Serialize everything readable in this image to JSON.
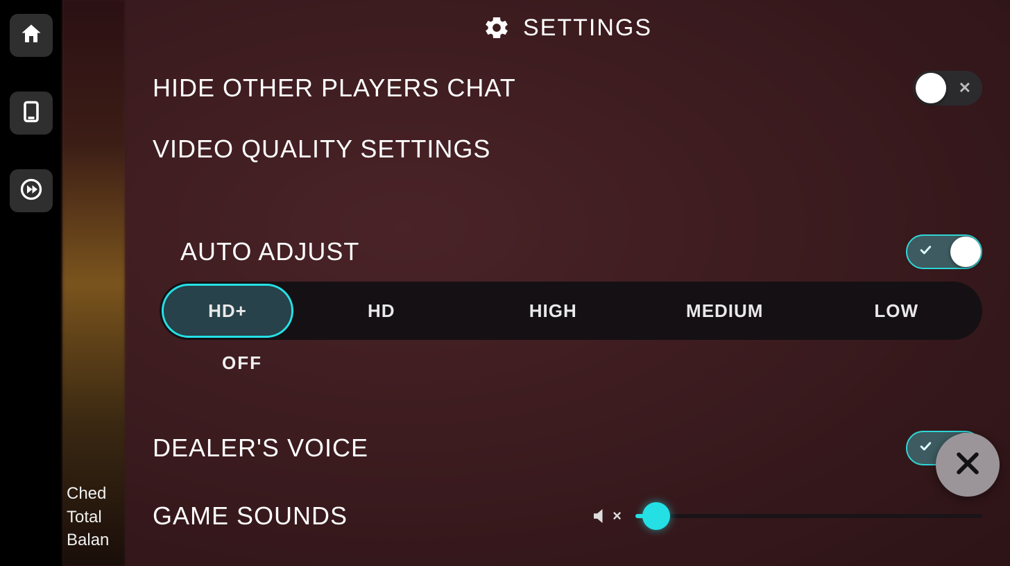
{
  "header": {
    "title": "SETTINGS"
  },
  "rows": {
    "hide_chat": {
      "label": "HIDE OTHER PLAYERS CHAT",
      "state": "off"
    },
    "video_quality_section": {
      "label": "VIDEO QUALITY SETTINGS"
    },
    "auto_adjust": {
      "label": "AUTO ADJUST",
      "state": "on"
    },
    "dealers_voice": {
      "label": "DEALER'S VOICE",
      "state": "on"
    },
    "game_sounds": {
      "label": "GAME SOUNDS",
      "slider_value": 6
    }
  },
  "quality": {
    "options": [
      "HD+",
      "HD",
      "HIGH",
      "MEDIUM",
      "LOW"
    ],
    "selected": "HD+",
    "below_label": "OFF"
  },
  "sidebar_text": {
    "line1": "Ched",
    "line2": "Total",
    "line3": "Balan"
  },
  "colors": {
    "accent": "#24e0e4"
  },
  "glyphs": {
    "toggle_off": "✕",
    "toggle_on_check": "✓",
    "mute_x": "×"
  }
}
